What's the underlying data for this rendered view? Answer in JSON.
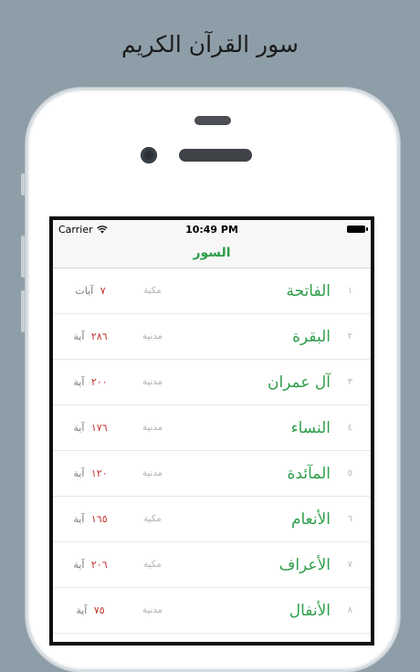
{
  "promo": {
    "title": "سور القرآن الكريم"
  },
  "status_bar": {
    "carrier": "Carrier",
    "time": "10:49 PM"
  },
  "nav": {
    "title": "السور"
  },
  "surahs": [
    {
      "index": "١",
      "name": "الفاتحة",
      "type": "مكية",
      "count": "٧",
      "unit": "آيات"
    },
    {
      "index": "٢",
      "name": "البقرة",
      "type": "مدنية",
      "count": "٢٨٦",
      "unit": "آية"
    },
    {
      "index": "٣",
      "name": "آل عمران",
      "type": "مدنية",
      "count": "٢٠٠",
      "unit": "آية"
    },
    {
      "index": "٤",
      "name": "النساء",
      "type": "مدنية",
      "count": "١٧٦",
      "unit": "آية"
    },
    {
      "index": "٥",
      "name": "المآئدة",
      "type": "مدنية",
      "count": "١٢٠",
      "unit": "آية"
    },
    {
      "index": "٦",
      "name": "الأنعام",
      "type": "مكية",
      "count": "١٦٥",
      "unit": "آية"
    },
    {
      "index": "٧",
      "name": "الأعراف",
      "type": "مكية",
      "count": "٢٠٦",
      "unit": "آية"
    },
    {
      "index": "٨",
      "name": "الأنفال",
      "type": "مدنية",
      "count": "٧٥",
      "unit": "آية"
    }
  ],
  "colors": {
    "accent": "#2e9e4a",
    "count_number": "#c0302b",
    "background": "#8e9ea8"
  }
}
